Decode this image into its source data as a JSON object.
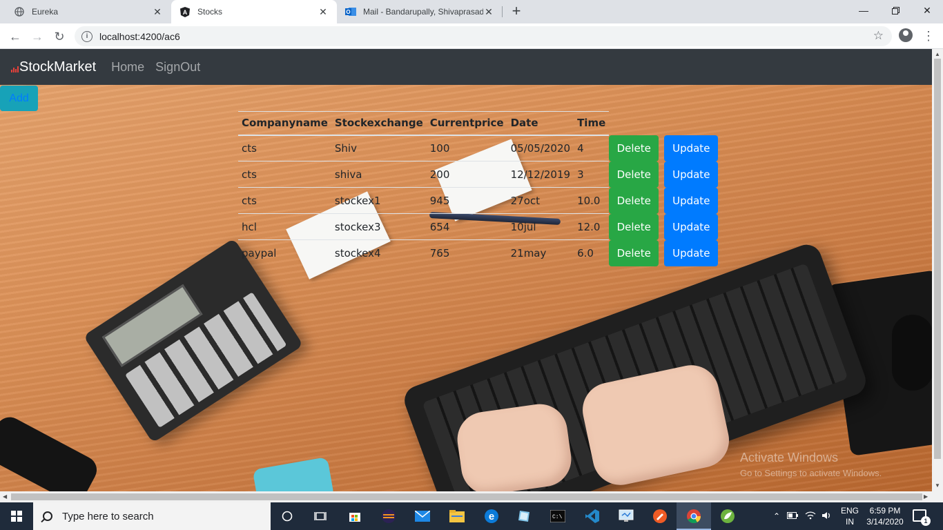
{
  "browser": {
    "tabs": [
      {
        "title": "Eureka",
        "icon": "globe-icon",
        "active": false
      },
      {
        "title": "Stocks",
        "icon": "angular-icon",
        "active": true
      },
      {
        "title": "Mail - Bandarupally, Shivaprasad",
        "icon": "outlook-icon",
        "active": false
      }
    ],
    "address": "localhost:4200/ac6"
  },
  "app": {
    "brand": "StockMarket",
    "nav": [
      "Home",
      "SignOut"
    ],
    "add_label": "Add",
    "columns": [
      "Companyname",
      "Stockexchange",
      "Currentprice",
      "Date",
      "Time"
    ],
    "rows": [
      {
        "company": "cts",
        "exchange": "Shiv",
        "price": "100",
        "date": "05/05/2020",
        "time": "4"
      },
      {
        "company": "cts",
        "exchange": "shiva",
        "price": "200",
        "date": "12/12/2019",
        "time": "3"
      },
      {
        "company": "cts",
        "exchange": "stockex1",
        "price": "945",
        "date": "27oct",
        "time": "10.0"
      },
      {
        "company": "hcl",
        "exchange": "stockex3",
        "price": "654",
        "date": "10jul",
        "time": "12.0"
      },
      {
        "company": "paypal",
        "exchange": "stockex4",
        "price": "765",
        "date": "21may",
        "time": "6.0"
      }
    ],
    "delete_label": "Delete",
    "update_label": "Update"
  },
  "watermark": {
    "line1": "Activate Windows",
    "line2": "Go to Settings to activate Windows."
  },
  "taskbar": {
    "search_placeholder": "Type here to search",
    "lang_top": "ENG",
    "lang_bottom": "IN",
    "time": "6:59 PM",
    "date": "3/14/2020",
    "notification_count": "1"
  },
  "colors": {
    "navbar_bg": "#343a40",
    "delete_green": "#28a745",
    "update_blue": "#007bff",
    "add_teal": "#17a2b8"
  }
}
